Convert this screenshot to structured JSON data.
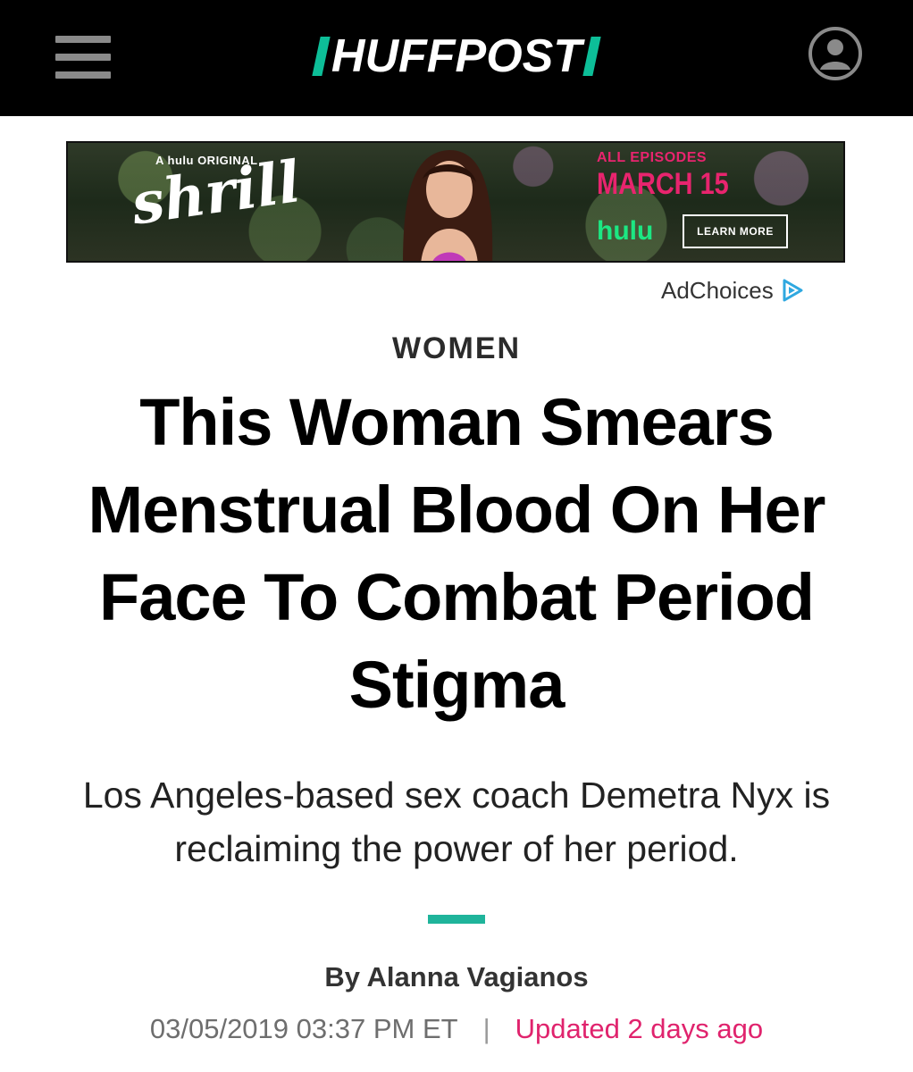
{
  "header": {
    "logo_text": "HUFFPOST",
    "brand_color": "#0dbe98",
    "menu_icon": "hamburger-menu-icon",
    "user_icon": "user-account-icon"
  },
  "ad": {
    "kicker": "A hulu ORIGINAL",
    "show": "shrill",
    "date_top": "ALL EPISODES",
    "date": "MARCH 15",
    "brand": "hulu",
    "cta": "LEARN MORE",
    "adchoices_label": "AdChoices",
    "accent_pink": "#e8246e",
    "accent_green": "#1ce783"
  },
  "article": {
    "section": "WOMEN",
    "headline": "This Woman Smears Menstrual Blood On Her Face To Combat Period Stigma",
    "dek": "Los Angeles-based sex coach Demetra Nyx is reclaiming the power of her period.",
    "divider_color": "#1fb49b",
    "byline_prefix": "By",
    "author": "Alanna Vagianos",
    "date": "03/05/2019 03:37 PM ET",
    "separator": "|",
    "updated": "Updated 2 days ago",
    "updated_color": "#e0236d"
  }
}
